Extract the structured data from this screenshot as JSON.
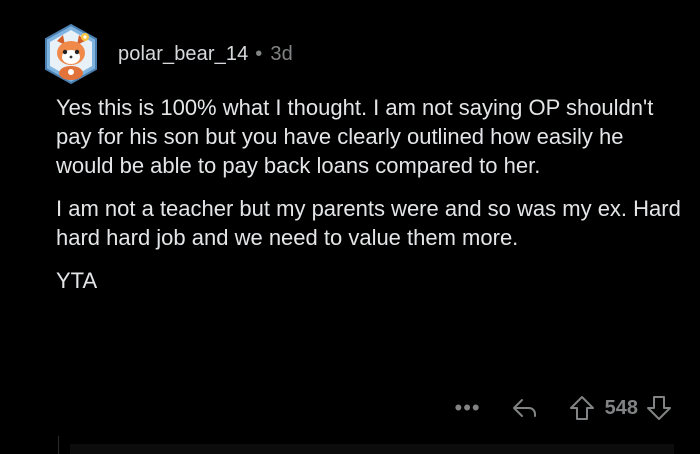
{
  "comment": {
    "author": "polar_bear_14",
    "separator": "•",
    "age": "3d",
    "avatar_icon": "red-panda-avatar-icon",
    "paragraphs": [
      "Yes this is 100% what I thought. I am not saying OP shouldn't pay for his son but you have clearly outlined how easily he would be able to pay back loans compared to her.",
      "I am not a teacher but my parents were and so was my ex. Hard hard hard job and we need to value them more.",
      "YTA"
    ],
    "actions": {
      "more_label": "•••",
      "reply_icon": "reply-arrow-icon",
      "upvote_icon": "upvote-arrow-icon",
      "score": "548",
      "downvote_icon": "downvote-arrow-icon"
    }
  },
  "colors": {
    "background": "#000000",
    "text": "#e3e5e7",
    "muted": "#818384",
    "avatar_frame": "#6ea8d8"
  }
}
